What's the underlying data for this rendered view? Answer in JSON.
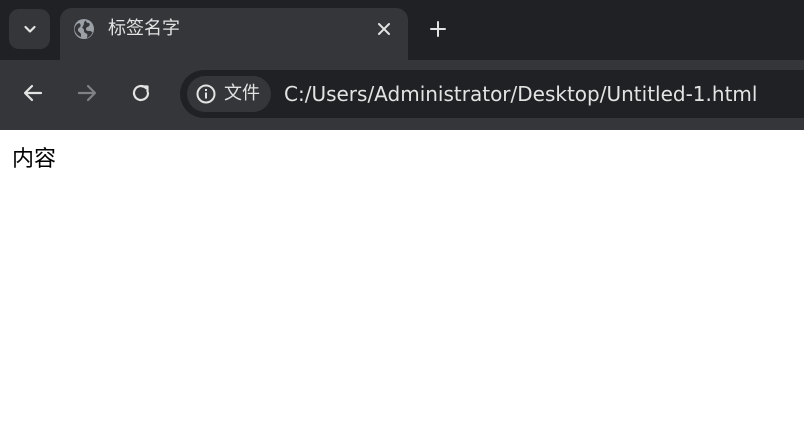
{
  "tab": {
    "title": "标签名字",
    "favicon": "globe-icon",
    "close_icon": "close-icon"
  },
  "tabstrip": {
    "tab_search_icon": "chevron-down-icon",
    "new_tab_icon": "plus-icon"
  },
  "toolbar": {
    "back_icon": "arrow-left-icon",
    "forward_icon": "arrow-right-icon",
    "reload_icon": "reload-icon"
  },
  "omnibox": {
    "site_info_icon": "info-icon",
    "site_chip_label": "文件",
    "url": "C:/Users/Administrator/Desktop/Untitled-1.html"
  },
  "page": {
    "content_text": "内容"
  },
  "colors": {
    "frame": "#202124",
    "toolbar": "#35363a",
    "text_light": "#e3e3e3",
    "icon_disabled": "#7f8184",
    "page_bg": "#ffffff"
  }
}
